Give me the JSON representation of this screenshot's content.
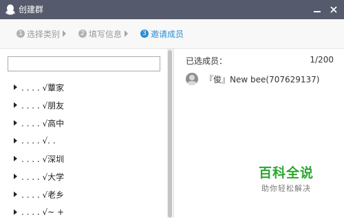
{
  "window": {
    "title": "创建群",
    "icon": "qq-penguin-icon",
    "minimize_icon": "minimize-icon",
    "close_icon": "close-icon"
  },
  "steps": [
    {
      "num": "1",
      "label": "选择类别",
      "active": false
    },
    {
      "num": "2",
      "label": "填写信息",
      "active": false
    },
    {
      "num": "3",
      "label": "邀请成员",
      "active": true
    }
  ],
  "search": {
    "value": "",
    "placeholder": ""
  },
  "groups": [
    {
      "label": ". . . . √蕈家"
    },
    {
      "label": ". . . . √朋友"
    },
    {
      "label": ". . . . √高中"
    },
    {
      "label": ". . . . √. ."
    },
    {
      "label": ". . . . √深圳"
    },
    {
      "label": ". . . . √大学"
    },
    {
      "label": ". . . . √老乡"
    },
    {
      "label": ". . . . √~ +"
    }
  ],
  "selected": {
    "label": "已选成员：",
    "count": "1/200",
    "members": [
      {
        "name": "『俊』New bee(707629137)"
      }
    ]
  },
  "watermark": {
    "title": "百科全说",
    "subtitle": "助你轻松解决"
  },
  "colors": {
    "titlebar": "#555a6c",
    "active_step": "#2a8fd6",
    "inactive_step": "#9a9a9a",
    "watermark": "#2aa62f"
  }
}
